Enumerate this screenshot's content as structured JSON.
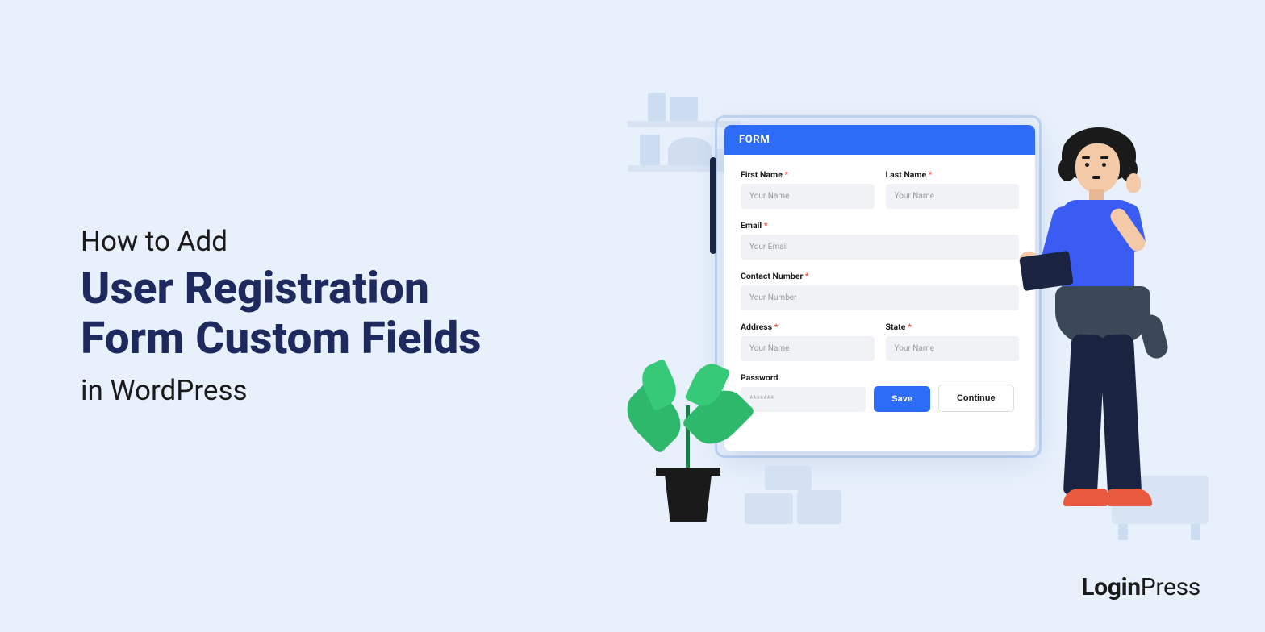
{
  "title": {
    "pretitle": "How to Add",
    "main_line1": "User Registration",
    "main_line2": "Form Custom Fields",
    "subtitle": "in WordPress"
  },
  "form": {
    "header": "FORM",
    "fields": {
      "first_name": {
        "label": "First Name",
        "placeholder": "Your Name",
        "required": true
      },
      "last_name": {
        "label": "Last Name",
        "placeholder": "Your Name",
        "required": true
      },
      "email": {
        "label": "Email",
        "placeholder": "Your Email",
        "required": true
      },
      "contact": {
        "label": "Contact Number",
        "placeholder": "Your Number",
        "required": true
      },
      "address": {
        "label": "Address",
        "placeholder": "Your Name",
        "required": true
      },
      "state": {
        "label": "State",
        "placeholder": "Your Name",
        "required": true
      },
      "password": {
        "label": "Password",
        "placeholder": "*******",
        "required": false
      }
    },
    "buttons": {
      "save": "Save",
      "continue": "Continue"
    },
    "required_mark": "*"
  },
  "brand": {
    "login": "Login",
    "press": "Press"
  }
}
